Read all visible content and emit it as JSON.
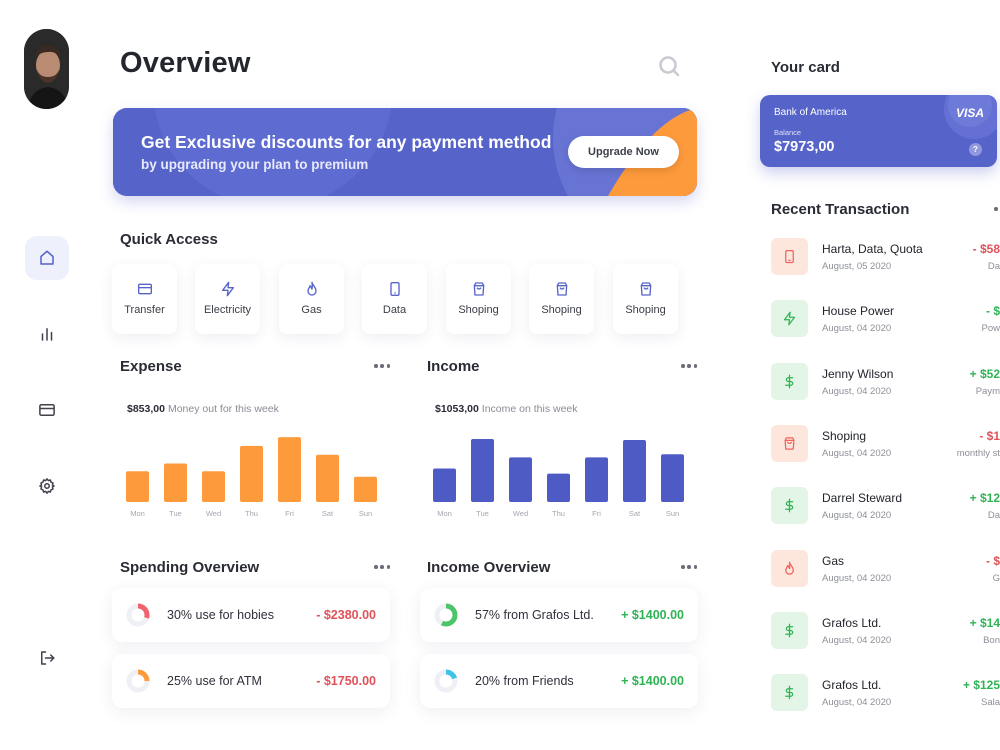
{
  "page": {
    "title": "Overview"
  },
  "colors": {
    "accent": "#5663c9",
    "orange": "#fd9a3b",
    "negative": "#e0525a",
    "positive": "#2fb455",
    "bars_expense": "#fd9a3b",
    "bars_income": "#4f5bc4"
  },
  "sidebar": {
    "avatar": "profile-photo",
    "items": [
      {
        "icon": "home-icon",
        "active": true
      },
      {
        "icon": "chart-icon",
        "active": false
      },
      {
        "icon": "card-icon",
        "active": false
      },
      {
        "icon": "settings-icon",
        "active": false
      }
    ],
    "logout_icon": "logout-icon"
  },
  "search": {
    "icon": "search-icon"
  },
  "promo": {
    "title": "Get Exclusive discounts for any payment method",
    "subtitle": "by upgrading your plan to premium",
    "button": "Upgrade Now"
  },
  "quick_access": {
    "title": "Quick Access",
    "items": [
      {
        "label": "Transfer",
        "icon": "card-icon"
      },
      {
        "label": "Electricity",
        "icon": "bolt-icon"
      },
      {
        "label": "Gas",
        "icon": "flame-icon"
      },
      {
        "label": "Data",
        "icon": "phone-icon"
      },
      {
        "label": "Shoping",
        "icon": "bag-icon"
      },
      {
        "label": "Shoping",
        "icon": "bag-icon"
      },
      {
        "label": "Shoping",
        "icon": "bag-icon"
      }
    ]
  },
  "expense": {
    "title": "Expense",
    "amount": "$853,00",
    "caption": "Money out for this week"
  },
  "income": {
    "title": "Income",
    "amount": "$1053,00",
    "caption": "Income on this week"
  },
  "chart_data": [
    {
      "type": "bar",
      "categories": [
        "Mon",
        "Tue",
        "Wed",
        "Thu",
        "Fri",
        "Sat",
        "Sun"
      ],
      "values": [
        28,
        35,
        28,
        51,
        59,
        43,
        23
      ],
      "ylim": [
        0,
        60
      ],
      "grid": false,
      "color": "#fd9a3b"
    },
    {
      "type": "bar",
      "categories": [
        "Mon",
        "Tue",
        "Wed",
        "Thu",
        "Fri",
        "Sat",
        "Sun"
      ],
      "values": [
        33,
        62,
        44,
        28,
        44,
        61,
        47
      ],
      "ylim": [
        0,
        65
      ],
      "grid": false,
      "color": "#4f5bc4"
    }
  ],
  "spending_overview": {
    "title": "Spending Overview",
    "items": [
      {
        "label": "30% use for hobies",
        "amount": "- $2380.00",
        "percent": 30,
        "color": "#f0626d"
      },
      {
        "label": "25% use for ATM",
        "amount": "- $1750.00",
        "percent": 25,
        "color": "#fd9a3b"
      }
    ]
  },
  "income_overview": {
    "title": "Income Overview",
    "items": [
      {
        "label": "57% from Grafos Ltd.",
        "amount": "+ $1400.00",
        "percent": 57,
        "color": "#4cc46a"
      },
      {
        "label": "20% from Friends",
        "amount": "+ $1400.00",
        "percent": 20,
        "color": "#3fc3e6"
      }
    ]
  },
  "your_card": {
    "title": "Your card",
    "bank": "Bank of America",
    "network": "VISA",
    "balance_label": "Balance",
    "balance": "$7973,00",
    "help": "?"
  },
  "recent": {
    "title": "Recent Transaction",
    "items": [
      {
        "name": "Harta, Data, Quota",
        "date": "August, 05 2020",
        "amount": "- $58",
        "category": "Da",
        "type": "neg",
        "icon": "phone-icon"
      },
      {
        "name": "House Power",
        "date": "August, 04 2020",
        "amount": "- $",
        "category": "Pow",
        "type": "pos-bolt",
        "icon": "bolt-icon"
      },
      {
        "name": "Jenny Wilson",
        "date": "August, 04 2020",
        "amount": "+ $52",
        "category": "Paym",
        "type": "pos",
        "icon": "dollar-icon"
      },
      {
        "name": "Shoping",
        "date": "August, 04 2020",
        "amount": "- $1",
        "category": "monthly st",
        "type": "neg",
        "icon": "bag-icon"
      },
      {
        "name": "Darrel Steward",
        "date": "August, 04 2020",
        "amount": "+ $12",
        "category": "Da",
        "type": "pos",
        "icon": "dollar-icon"
      },
      {
        "name": "Gas",
        "date": "August, 04 2020",
        "amount": "- $",
        "category": "G",
        "type": "neg",
        "icon": "flame-icon"
      },
      {
        "name": "Grafos Ltd.",
        "date": "August, 04 2020",
        "amount": "+ $14",
        "category": "Bon",
        "type": "pos",
        "icon": "dollar-icon"
      },
      {
        "name": "Grafos Ltd.",
        "date": "August, 04 2020",
        "amount": "+ $125",
        "category": "Sala",
        "type": "pos",
        "icon": "dollar-icon"
      }
    ]
  }
}
